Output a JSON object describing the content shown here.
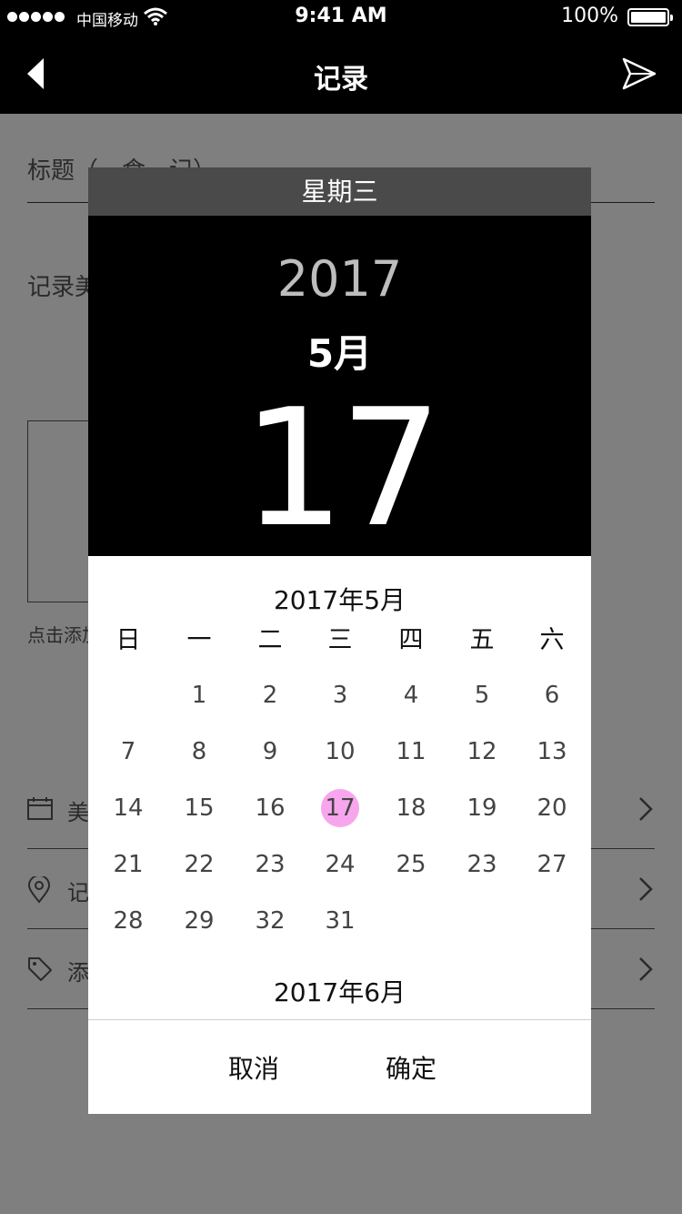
{
  "status_bar": {
    "carrier": "中国移动",
    "time": "9:41 AM",
    "battery": "100%"
  },
  "nav": {
    "title": "记录"
  },
  "form": {
    "title_label": "标题（一食一记）",
    "content_label": "记录美食",
    "image_hint": "点击添加图片",
    "rows": [
      {
        "label": "美食时间",
        "icon": "calendar-icon"
      },
      {
        "label": "记录位置",
        "icon": "location-pin-icon"
      },
      {
        "label": "添加标签",
        "icon": "tag-icon"
      }
    ]
  },
  "dialog": {
    "weekday": "星期三",
    "year": "2017",
    "month": "5月",
    "day": "17",
    "current_month_title": "2017年5月",
    "next_month_title": "2017年6月",
    "weekday_headers": [
      "日",
      "一",
      "二",
      "三",
      "四",
      "五",
      "六"
    ],
    "weeks": [
      [
        "",
        "1",
        "2",
        "3",
        "4",
        "5",
        "6"
      ],
      [
        "7",
        "8",
        "9",
        "10",
        "11",
        "12",
        "13"
      ],
      [
        "14",
        "15",
        "16",
        "17",
        "18",
        "19",
        "20"
      ],
      [
        "21",
        "22",
        "23",
        "24",
        "25",
        "23",
        "27"
      ],
      [
        "28",
        "29",
        "32",
        "31",
        "",
        "",
        ""
      ]
    ],
    "selected_day": "17",
    "cancel_label": "取消",
    "confirm_label": "确定"
  },
  "colors": {
    "selected_highlight": "#f7a6ee",
    "header_bg": "#000000",
    "weekday_bar_bg": "#4a4a4a"
  }
}
